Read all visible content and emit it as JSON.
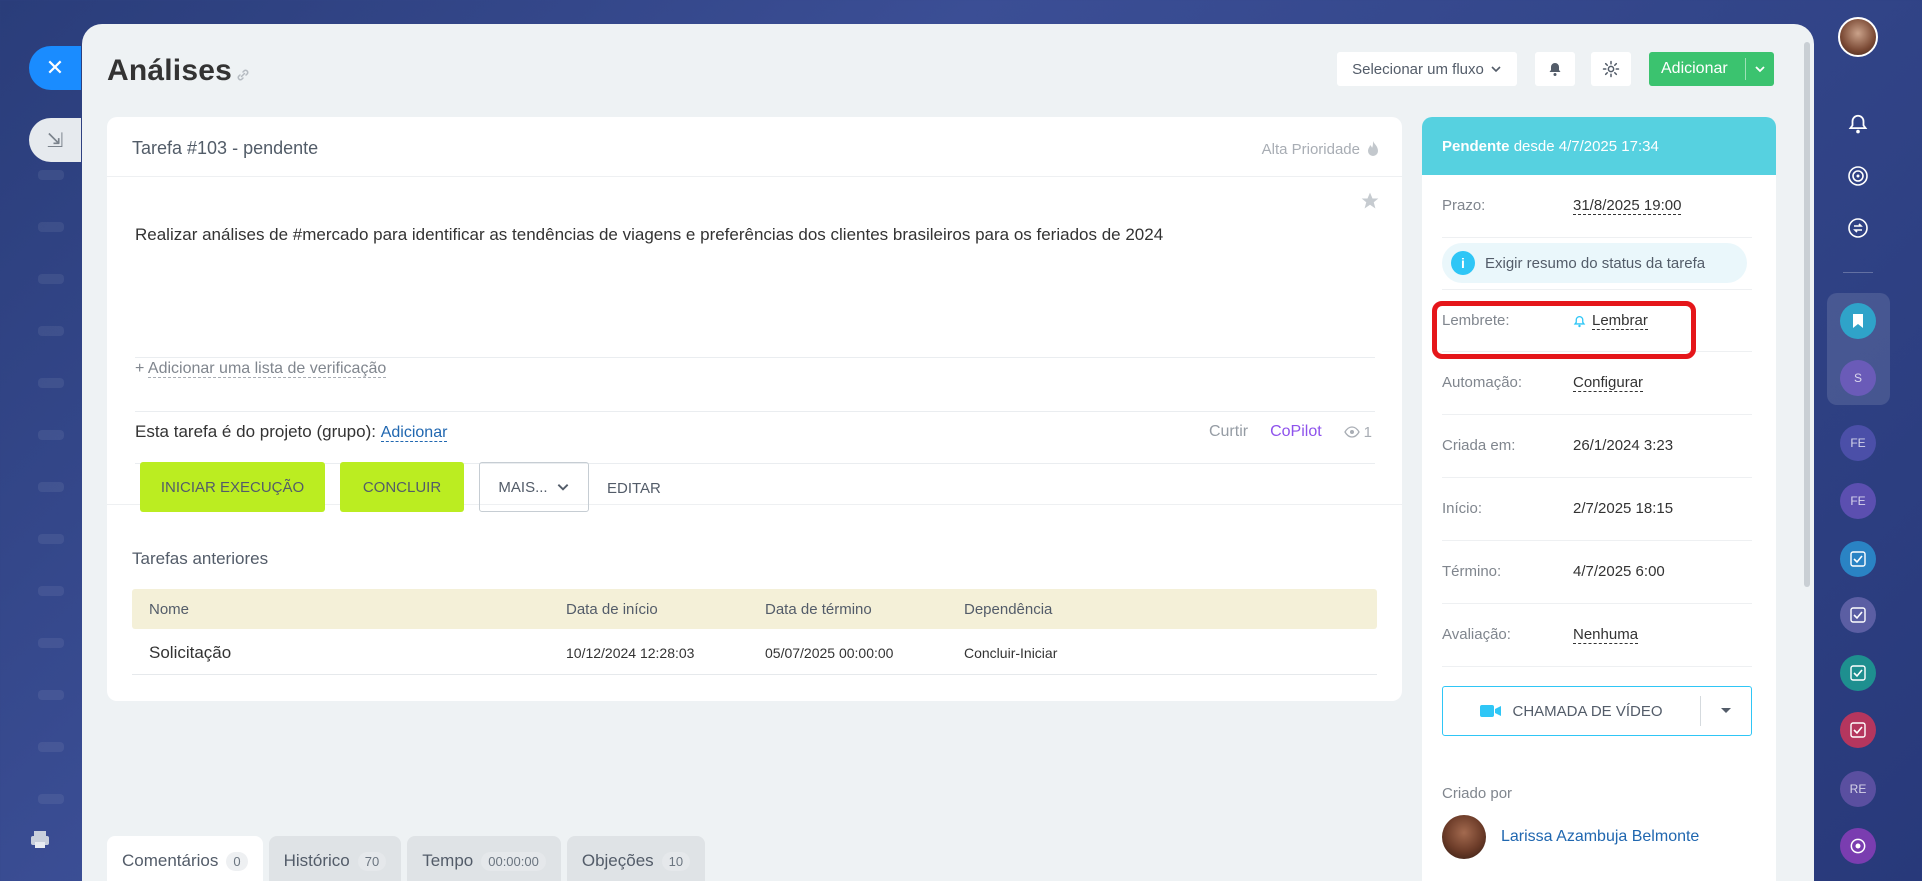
{
  "page": {
    "title": "Análises"
  },
  "toolbar": {
    "flow_select": "Selecionar um fluxo",
    "add_label": "Adicionar"
  },
  "task": {
    "title": "Tarefa #103 - pendente",
    "priority": "Alta Prioridade",
    "description": "Realizar análises de #mercado para identificar as tendências de viagens e preferências dos clientes brasileiros para os feriados de 2024",
    "checklist_prefix": "+",
    "checklist_link": "Adicionar uma lista de verificação",
    "project_label": "Esta tarefa é do projeto (grupo):",
    "project_link": "Adicionar",
    "like": "Curtir",
    "copilot": "CoPilot",
    "views": "1",
    "buttons": {
      "start": "INICIAR EXECUÇÃO",
      "finish": "CONCLUIR",
      "more": "MAIS...",
      "edit": "EDITAR"
    }
  },
  "previous": {
    "title": "Tarefas anteriores",
    "columns": [
      "Nome",
      "Data de início",
      "Data de término",
      "Dependência"
    ],
    "rows": [
      {
        "name": "Solicitação",
        "start": "10/12/2024 12:28:03",
        "end": "05/07/2025 00:00:00",
        "dependency": "Concluir-Iniciar"
      }
    ]
  },
  "tabs": [
    {
      "label": "Comentários",
      "count": "0"
    },
    {
      "label": "Histórico",
      "count": "70"
    },
    {
      "label": "Tempo",
      "count": "00:00:00"
    },
    {
      "label": "Objeções",
      "count": "10"
    }
  ],
  "sidebar": {
    "status_strong": "Pendente",
    "status_rest": "desde 4/7/2025 17:34",
    "deadline_label": "Prazo:",
    "deadline_value": "31/8/2025 19:00",
    "resume_text": "Exigir resumo do status da tarefa",
    "reminder_label": "Lembrete:",
    "reminder_value": "Lembrar",
    "automation_label": "Automação:",
    "automation_value": "Configurar",
    "created_label": "Criada em:",
    "created_value": "26/1/2024 3:23",
    "start_label": "Início:",
    "start_value": "2/7/2025 18:15",
    "end_label": "Término:",
    "end_value": "4/7/2025 6:00",
    "rating_label": "Avaliação:",
    "rating_value": "Nenhuma",
    "video_call": "CHAMADA DE VÍDEO",
    "created_by_label": "Criado por",
    "creator_name": "Larissa Azambuja Belmonte"
  },
  "rail": {
    "initials": [
      "S",
      "FE",
      "FE",
      "RE"
    ]
  },
  "colors": {
    "accent_green": "#bbed21",
    "add_green": "#3bc36f",
    "status_cyan": "#56d1e0",
    "highlight_red": "#e5161a",
    "link_blue": "#2067b0"
  }
}
